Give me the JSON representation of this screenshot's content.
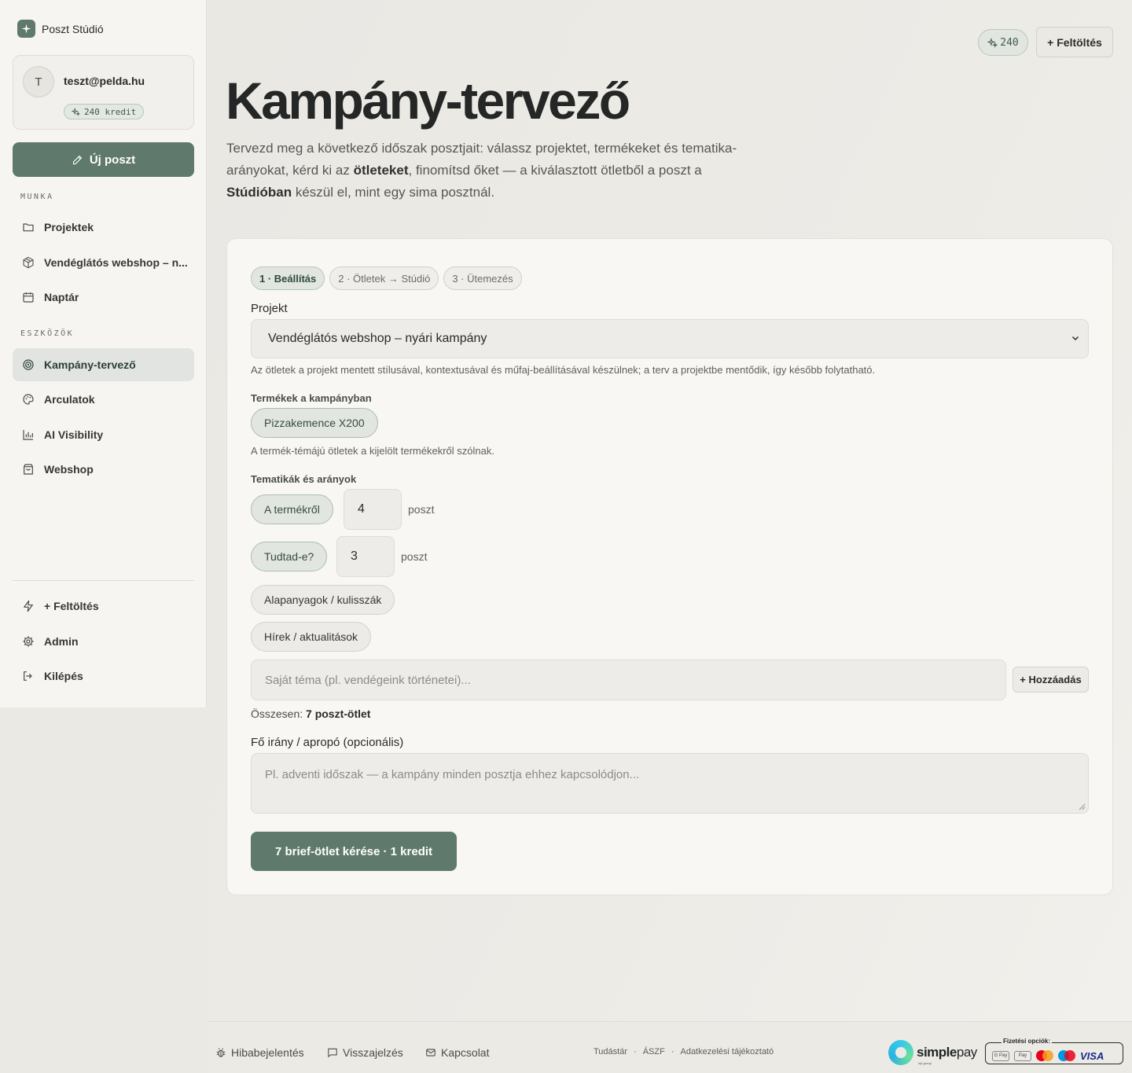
{
  "brand": {
    "name": "Poszt Stúdió"
  },
  "user": {
    "initial": "T",
    "email": "teszt@pelda.hu",
    "credits": "240 kredit"
  },
  "sidebar": {
    "new_post": "Új poszt",
    "section_work": "MUNKA",
    "section_tools": "ESZKÖZÖK",
    "work_items": [
      {
        "label": "Projektek",
        "icon": "folder-icon"
      },
      {
        "label": "Vendéglátós webshop – n...",
        "icon": "box-icon"
      },
      {
        "label": "Naptár",
        "icon": "calendar-icon"
      }
    ],
    "tool_items": [
      {
        "label": "Kampány-tervező",
        "icon": "target-icon",
        "active": true
      },
      {
        "label": "Arculatok",
        "icon": "palette-icon"
      },
      {
        "label": "AI Visibility",
        "icon": "bar-chart-icon"
      },
      {
        "label": "Webshop",
        "icon": "shopping-bag-icon"
      }
    ],
    "bottom_items": [
      {
        "label": "+ Feltöltés",
        "icon": "bolt-icon"
      },
      {
        "label": "Admin",
        "icon": "gear-icon"
      },
      {
        "label": "Kilépés",
        "icon": "logout-icon"
      }
    ]
  },
  "header": {
    "credit_badge": "240",
    "upload_button": "+ Feltöltés"
  },
  "page": {
    "title": "Kampány-tervező",
    "desc_1": "Tervezd meg a következő időszak posztjait: válassz projektet, termékeket és tematika-arányokat, kérd ki az ",
    "desc_bold_1": "ötleteket",
    "desc_2": ", finomítsd őket — a kiválasztott ötletből a poszt a ",
    "desc_bold_2": "Stúdióban",
    "desc_3": " készül el, mint egy sima posztnál."
  },
  "steps": [
    {
      "label": "1 · Beállítás",
      "active": true
    },
    {
      "label": "2 · Ötletek → Stúdió",
      "active": false
    },
    {
      "label": "3 · Ütemezés",
      "active": false
    }
  ],
  "form": {
    "project_label": "Projekt",
    "project_value": "Vendéglátós webshop – nyári kampány",
    "project_hint": "Az ötletek a projekt mentett stílusával, kontextusával és műfaj-beállításával készülnek; a terv a projektbe mentődik, így később folytatható.",
    "products_label": "Termékek a kampányban",
    "product_chip": "Pizzakemence X200",
    "products_hint": "A termék-témájú ötletek a kijelölt termékekről szólnak.",
    "themes_label": "Tematikák és arányok",
    "themes": [
      {
        "label": "A termékről",
        "count": "4",
        "unit": "poszt"
      },
      {
        "label": "Tudtad-e?",
        "count": "3",
        "unit": "poszt"
      },
      {
        "label": "Alapanyagok / kulisszák"
      },
      {
        "label": "Hírek / aktualitások"
      }
    ],
    "custom_theme_placeholder": "Saját téma (pl. vendégeink történetei)...",
    "add_button": "+ Hozzáadás",
    "total_prefix": "Összesen:",
    "total_value": "7 poszt-ötlet",
    "direction_label": "Fő irány / apropó (opcionális)",
    "direction_placeholder": "Pl. adventi időszak — a kampány minden posztja ehhez kapcsolódjon...",
    "submit": "7 brief-ötlet kérése · 1 kredit"
  },
  "footer": {
    "bug_report": "Hibabejelentés",
    "feedback": "Visszajelzés",
    "contact": "Kapcsolat",
    "kb": "Tudástár",
    "terms": "ÁSZF",
    "privacy": "Adatkezelési tájékoztató",
    "sep": "·",
    "simplepay_a": "simple",
    "simplepay_b": "pay",
    "simplepay_sub": "otp group",
    "payment_options": "Fizetési opciók:",
    "gpay": "G Pay",
    "applepay": " Pay",
    "visa": "VISA"
  },
  "colors": {
    "accent": "#5f7a6c",
    "accent_light": "#e1e6e1",
    "background": "#ebe9e4"
  }
}
